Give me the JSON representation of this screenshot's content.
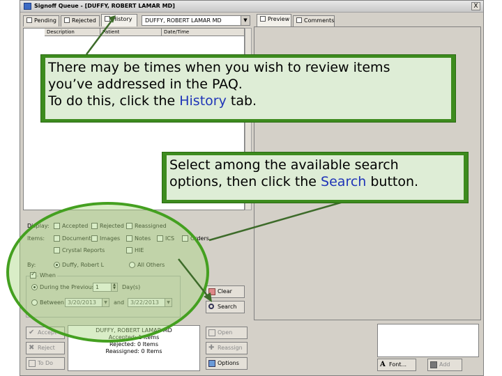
{
  "window": {
    "title": "Signoff Queue - [DUFFY, ROBERT LAMAR MD]",
    "close_label": "X"
  },
  "left_tabs": {
    "pending": "Pending",
    "rejected": "Rejected",
    "history": "History"
  },
  "user_select": {
    "value": "DUFFY, ROBERT LAMAR MD"
  },
  "columns": {
    "description": "Description",
    "patient": "Patient",
    "date_time": "Date/Time"
  },
  "right_tabs": {
    "preview": "Preview",
    "comments": "Comments"
  },
  "options": {
    "display_label": "Display:",
    "display": {
      "accepted": "Accepted",
      "rejected": "Rejected",
      "reassigned": "Reassigned"
    },
    "items_label": "Items:",
    "items": {
      "documents": "Documents",
      "images": "Images",
      "notes": "Notes",
      "ics": "ICS",
      "orders": "Orders",
      "crystal_reports": "Crystal Reports",
      "hie": "HIE"
    },
    "by_label": "By:",
    "by_user": "Duffy, Robert L",
    "by_others": "All Others",
    "when_label": "When",
    "during_previous": "During the Previous",
    "days_value": "1",
    "days_unit": "Day(s)",
    "between": "Between",
    "start_date": "3/20/2013",
    "and_label": "and",
    "end_date": "3/22/2013",
    "clear_label": "Clear",
    "search_label": "Search"
  },
  "actions": {
    "accept": "Accept",
    "reject": "Reject",
    "todo": "To Do",
    "open": "Open",
    "reassign": "Reassign",
    "options": "Options"
  },
  "status_lines": {
    "line1": "DUFFY, ROBERT LAMAR MD",
    "line2": "Accepted: 1 Items",
    "line3": "Rejected: 0 Items",
    "line4": "Reassigned: 0 Items"
  },
  "note_buttons": {
    "font": "Font...",
    "add": "Add"
  },
  "callout1": {
    "line1": "There may be times when you wish to review items",
    "line2": "you’ve addressed in the PAQ.",
    "line3_pre": "To do this, click the ",
    "line3_link": "History",
    "line3_post": " tab."
  },
  "callout2": {
    "line1": "Select among the available search",
    "line2_pre": "options, then click the ",
    "line2_link": "Search",
    "line2_post": " button."
  },
  "colors": {
    "callout_border": "#3d8b1e",
    "callout_bg": "#deedd6",
    "highlight_text": "#1f34b8",
    "ellipse": "#44a020"
  }
}
